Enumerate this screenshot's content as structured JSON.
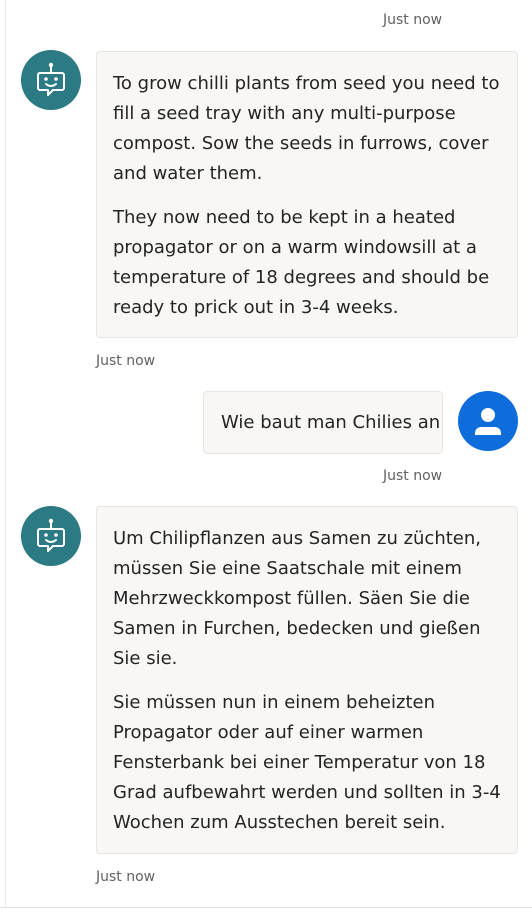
{
  "conversation": {
    "messages": [
      {
        "sender": "bot",
        "avatar_icon": "bot-icon",
        "timestamp_before": "Just now",
        "paragraphs": [
          "To grow chilli plants from seed you need to fill a seed tray with any multi-purpose compost. Sow the seeds in furrows, cover and water them.",
          "They now need to be kept in a heated propagator or on a warm windowsill at a temperature of 18 degrees and should be ready to prick out in 3-4 weeks."
        ],
        "timestamp": "Just now"
      },
      {
        "sender": "user",
        "avatar_icon": "person-icon",
        "text": "Wie baut man Chilies an",
        "timestamp": "Just now"
      },
      {
        "sender": "bot",
        "avatar_icon": "bot-icon",
        "paragraphs": [
          "Um Chilipflanzen aus Samen zu züchten, müssen Sie eine Saatschale mit einem Mehrzweckkompost füllen. Säen Sie die Samen in Furchen, bedecken und gießen Sie sie.",
          "Sie müssen nun in einem beheizten Propagator oder auf einer warmen Fensterbank bei einer Temperatur von 18 Grad aufbewahrt werden und sollten in 3-4 Wochen zum Ausstechen bereit sein."
        ],
        "timestamp": "Just now"
      }
    ]
  },
  "colors": {
    "bot_avatar": "#2b7a84",
    "user_avatar": "#0f6cdb",
    "bubble_background": "#f8f7f5",
    "timestamp_text": "#616161"
  }
}
